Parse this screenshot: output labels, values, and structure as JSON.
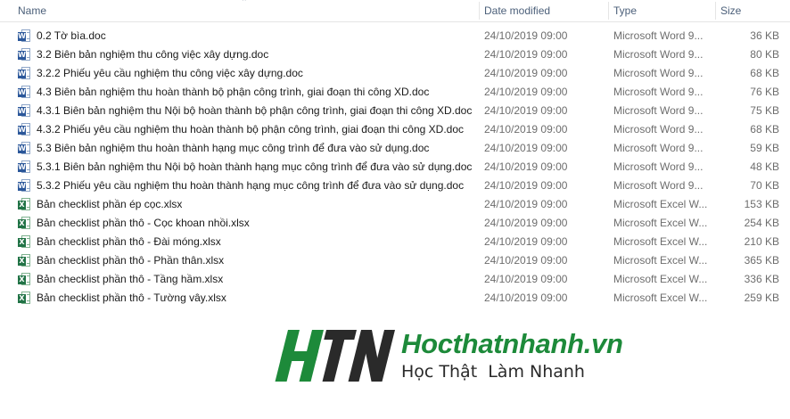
{
  "columns": {
    "name": "Name",
    "date_modified": "Date modified",
    "type": "Type",
    "size": "Size"
  },
  "files": [
    {
      "name": "0.2 Tờ bìa.doc",
      "date": "24/10/2019 09:00",
      "type": "Microsoft Word 9...",
      "size": "36 KB",
      "icon": "word-doc-icon"
    },
    {
      "name": "3.2 Biên bản nghiệm thu công việc xây dựng.doc",
      "date": "24/10/2019 09:00",
      "type": "Microsoft Word 9...",
      "size": "80 KB",
      "icon": "word-doc-icon"
    },
    {
      "name": "3.2.2 Phiếu yêu cầu nghiệm thu công việc xây dựng.doc",
      "date": "24/10/2019 09:00",
      "type": "Microsoft Word 9...",
      "size": "68 KB",
      "icon": "word-doc-icon"
    },
    {
      "name": "4.3 Biên bản nghiệm thu hoàn thành bộ phận công trình, giai đoạn thi công XD.doc",
      "date": "24/10/2019 09:00",
      "type": "Microsoft Word 9...",
      "size": "76 KB",
      "icon": "word-doc-icon"
    },
    {
      "name": "4.3.1 Biên bản nghiệm thu Nội bộ hoàn thành bộ phận công trình, giai đoạn thi công XD.doc",
      "date": "24/10/2019 09:00",
      "type": "Microsoft Word 9...",
      "size": "75 KB",
      "icon": "word-doc-icon"
    },
    {
      "name": "4.3.2 Phiếu yêu cầu nghiệm thu hoàn thành bộ phận công trình, giai đoạn thi công XD.doc",
      "date": "24/10/2019 09:00",
      "type": "Microsoft Word 9...",
      "size": "68 KB",
      "icon": "word-doc-icon"
    },
    {
      "name": "5.3 Biên bản nghiệm thu hoàn thành hạng mục công trình để đưa vào sử dụng.doc",
      "date": "24/10/2019 09:00",
      "type": "Microsoft Word 9...",
      "size": "59 KB",
      "icon": "word-doc-icon"
    },
    {
      "name": "5.3.1 Biên bản nghiệm thu Nội bộ hoàn thành hạng mục công trình để đưa vào sử dụng.doc",
      "date": "24/10/2019 09:00",
      "type": "Microsoft Word 9...",
      "size": "48 KB",
      "icon": "word-doc-icon"
    },
    {
      "name": "5.3.2 Phiếu yêu cầu nghiệm thu hoàn thành hạng mục công trình để đưa vào sử dụng.doc",
      "date": "24/10/2019 09:00",
      "type": "Microsoft Word 9...",
      "size": "70 KB",
      "icon": "word-doc-icon"
    },
    {
      "name": "Bản checklist phần ép cọc.xlsx",
      "date": "24/10/2019 09:00",
      "type": "Microsoft Excel W...",
      "size": "153 KB",
      "icon": "excel-sheet-icon"
    },
    {
      "name": "Bản checklist phần thô - Cọc khoan nhồi.xlsx",
      "date": "24/10/2019 09:00",
      "type": "Microsoft Excel W...",
      "size": "254 KB",
      "icon": "excel-sheet-icon"
    },
    {
      "name": "Bản checklist phần thô - Đài móng.xlsx",
      "date": "24/10/2019 09:00",
      "type": "Microsoft Excel W...",
      "size": "210 KB",
      "icon": "excel-sheet-icon"
    },
    {
      "name": "Bản checklist phần thô - Phần thân.xlsx",
      "date": "24/10/2019 09:00",
      "type": "Microsoft Excel W...",
      "size": "365 KB",
      "icon": "excel-sheet-icon"
    },
    {
      "name": "Bản checklist phần thô - Tầng hầm.xlsx",
      "date": "24/10/2019 09:00",
      "type": "Microsoft Excel W...",
      "size": "336 KB",
      "icon": "excel-sheet-icon"
    },
    {
      "name": "Bản checklist phần thô - Tường vây.xlsx",
      "date": "24/10/2019 09:00",
      "type": "Microsoft Excel W...",
      "size": "259 KB",
      "icon": "excel-sheet-icon"
    }
  ],
  "watermark": {
    "logo_letters": "HTN",
    "site": "Hocthatnhanh.vn",
    "tagline": "Học Thật  Làm Nhanh",
    "green": "#1d8a3a",
    "dark": "#2a2a2a"
  }
}
